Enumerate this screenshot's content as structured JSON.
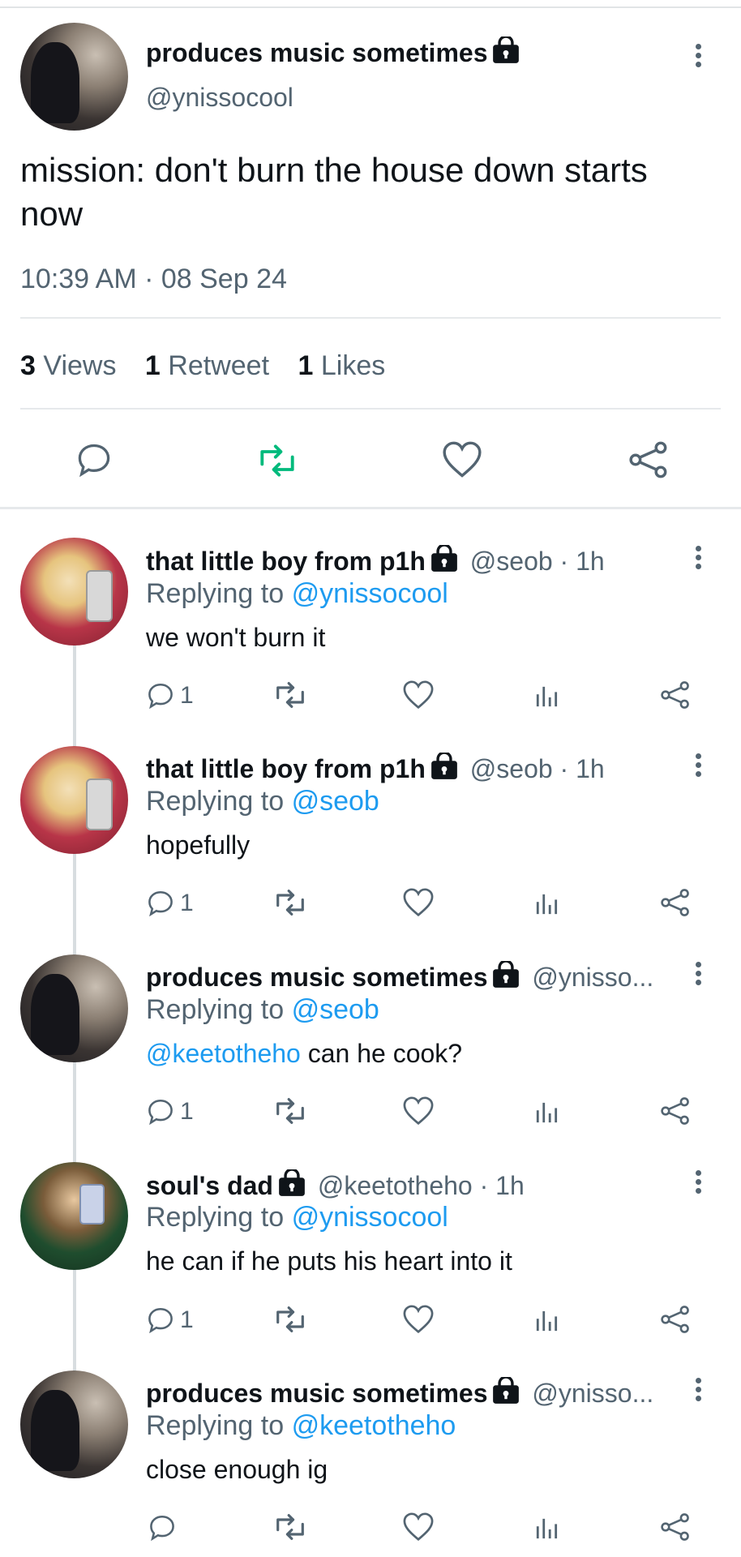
{
  "main_tweet": {
    "name": "produces music sometimes",
    "handle": "@ynissocool",
    "text_line1": "mission: don't burn the house down starts",
    "text_line2": "now",
    "timestamp": "10:39 AM · 08 Sep 24",
    "views_count": "3",
    "views_label": "Views",
    "retweet_count": "1",
    "retweet_label": "Retweet",
    "likes_count": "1",
    "likes_label": "Likes"
  },
  "replies": [
    {
      "name": "that little boy from p1h",
      "handle": "@seob · 1h",
      "replying_label": "Replying to",
      "replying_to": "@ynissocool",
      "text": "we won't burn it",
      "reply_count": "1"
    },
    {
      "name": "that little boy from p1h",
      "handle": "@seob · 1h",
      "replying_label": "Replying to",
      "replying_to": "@seob",
      "text": "hopefully",
      "reply_count": "1"
    },
    {
      "name": "produces music sometimes",
      "handle": "@ynisso...",
      "replying_label": "Replying to",
      "replying_to": "@seob",
      "mention": "@keetotheho",
      "text": " can he cook?",
      "reply_count": "1"
    },
    {
      "name": "soul's dad",
      "handle": "@keetotheho · 1h",
      "replying_label": "Replying to",
      "replying_to": "@ynissocool",
      "text": "he can if he puts his heart into it",
      "reply_count": "1"
    },
    {
      "name": "produces music sometimes",
      "handle": "@ynisso...",
      "replying_label": "Replying to",
      "replying_to": "@keetotheho",
      "text": "close enough ig",
      "reply_count": ""
    }
  ],
  "colors": {
    "accent": "#1d9bf0",
    "retweet_green": "#00ba7c",
    "muted": "#536471",
    "text": "#0f1419"
  }
}
